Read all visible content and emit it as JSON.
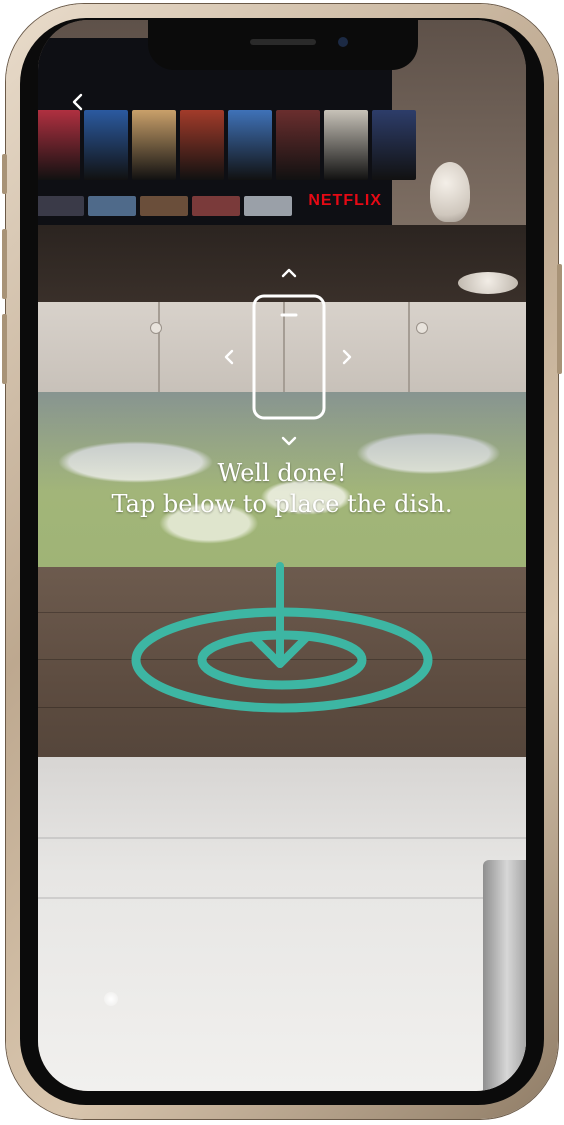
{
  "app": {
    "back_icon": "chevron-left-icon"
  },
  "scene": {
    "tv_brand_text": "NETFLIX",
    "tv_posters": [
      {
        "color": "#b03040"
      },
      {
        "color": "#2b5aa0"
      },
      {
        "color": "#c9a06a"
      },
      {
        "color": "#a23b2a"
      },
      {
        "color": "#3f72b8"
      },
      {
        "color": "#6a2e2e"
      },
      {
        "color": "#c7c2b8"
      },
      {
        "color": "#2d3d6a"
      }
    ]
  },
  "guide": {
    "phone_icon": "phone-outline-icon",
    "arrow_up_icon": "chevron-up-icon",
    "arrow_down_icon": "chevron-down-icon",
    "arrow_left_icon": "chevron-left-icon",
    "arrow_right_icon": "chevron-right-icon"
  },
  "instruction": {
    "line1": "Well done!",
    "line2": "Tap below to place the dish."
  },
  "placement_target": {
    "icon": "down-arrow-target-icon",
    "color": "#3db6a3"
  }
}
